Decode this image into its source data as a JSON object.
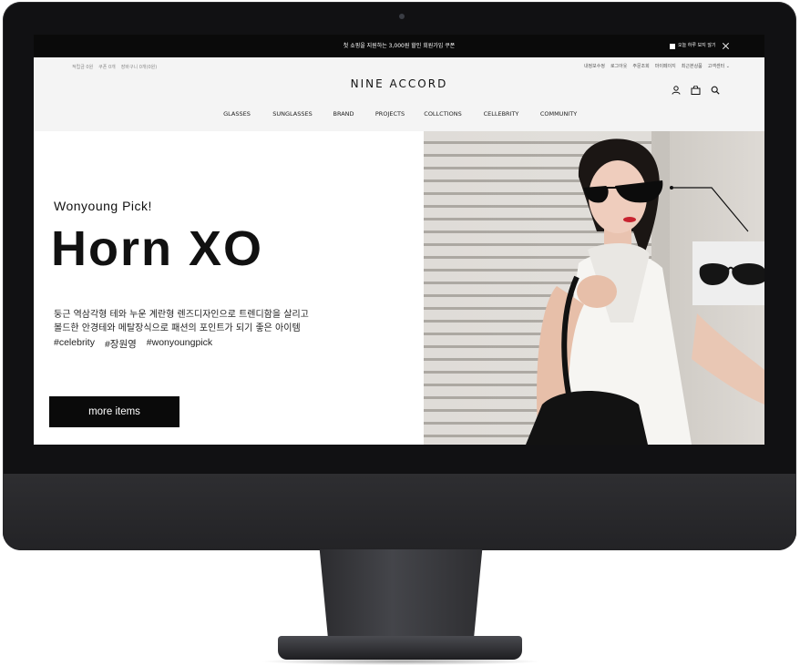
{
  "announce": {
    "text": "첫 쇼핑을 지원하는 3,000원 할인 회원가입 쿠폰",
    "hide_today": "오늘 하루 보지 않기"
  },
  "util_left": [
    "적립금 0원",
    "쿠폰 0개",
    "장바구니 0개(0원)"
  ],
  "util_right": [
    "내정보수정",
    "로그아웃",
    "주문조회",
    "마이페이지",
    "최근본상품",
    "고객센터"
  ],
  "logo": "NINE ACCORD",
  "icons": [
    "user-icon",
    "bag-icon",
    "search-icon"
  ],
  "nav": [
    "GLASSES",
    "SUNGLASSES",
    "BRAND",
    "PROJECTS",
    "COLLCTIONS",
    "CELLEBRITY",
    "COMMUNITY"
  ],
  "hero": {
    "subtitle": "Wonyoung Pick!",
    "title": "Horn XO",
    "desc_line1": "둥근 역삼각형 테와 누운 계란형 렌즈디자인으로 트렌디함을 살리고",
    "desc_line2": "볼드한 안경테와 메탈장식으로 패션의 포인트가 되기 좋은 아이템",
    "tags": [
      "#celebrity",
      "#장원영",
      "#wonyoungpick"
    ],
    "button": "more items"
  },
  "colors": {
    "announce_bg": "#0a0a0a",
    "header_bg": "#f4f4f4",
    "button_bg": "#0a0a0a",
    "bezel": "#111113"
  }
}
